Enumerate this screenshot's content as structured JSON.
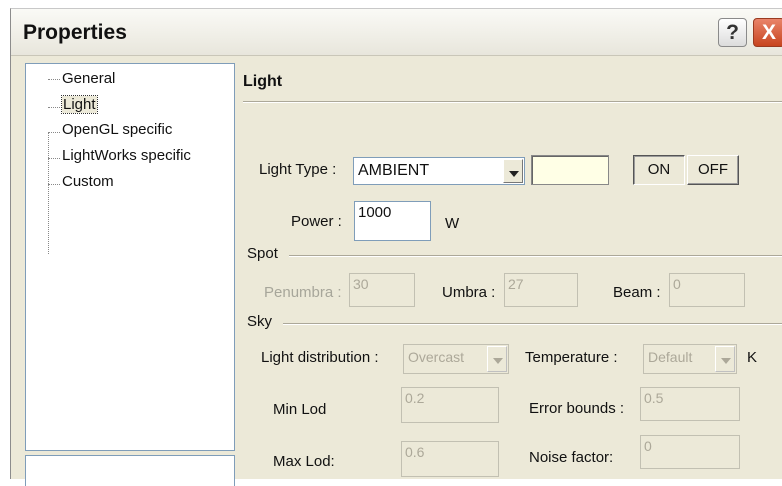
{
  "window": {
    "title": "Properties",
    "help_label": "?",
    "close_label": "X"
  },
  "tree": {
    "items": [
      {
        "label": "General",
        "selected": false
      },
      {
        "label": "Light",
        "selected": true
      },
      {
        "label": "OpenGL specific",
        "selected": false
      },
      {
        "label": "LightWorks specific",
        "selected": false
      },
      {
        "label": "Custom",
        "selected": false
      }
    ]
  },
  "panel": {
    "title": "Light",
    "light_type": {
      "label": "Light Type :",
      "value": "AMBIENT"
    },
    "on_label": "ON",
    "off_label": "OFF",
    "color_swatch": "#ffffe6",
    "power": {
      "label": "Power :",
      "value": "1000",
      "unit": "W"
    },
    "spot": {
      "label": "Spot",
      "penumbra": {
        "label": "Penumbra :",
        "value": "30"
      },
      "umbra": {
        "label": "Umbra :",
        "value": "27"
      },
      "beam": {
        "label": "Beam :",
        "value": "0"
      }
    },
    "sky": {
      "label": "Sky",
      "light_distribution": {
        "label": "Light distribution :",
        "value": "Overcast"
      },
      "temperature": {
        "label": "Temperature :",
        "value": "Default",
        "unit": "K"
      },
      "min_lod": {
        "label": "Min Lod",
        "value": "0.2"
      },
      "error_bounds": {
        "label": "Error bounds :",
        "value": "0.5"
      },
      "max_lod": {
        "label": "Max Lod:",
        "value": "0.6"
      },
      "noise_factor": {
        "label": "Noise factor:",
        "value": "0"
      }
    }
  }
}
